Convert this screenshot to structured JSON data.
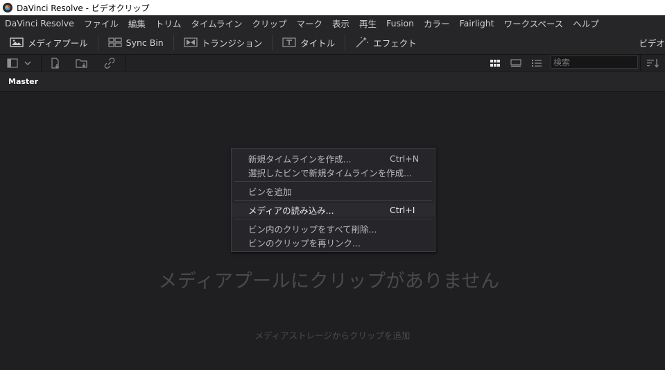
{
  "window": {
    "title": "DaVinci Resolve - ビデオクリップ"
  },
  "menubar": {
    "items": [
      "DaVinci Resolve",
      "ファイル",
      "編集",
      "トリム",
      "タイムライン",
      "クリップ",
      "マーク",
      "表示",
      "再生",
      "Fusion",
      "カラー",
      "Fairlight",
      "ワークスペース",
      "ヘルプ"
    ]
  },
  "toolbar": {
    "media_pool": "メディアプール",
    "sync_bin": "Sync Bin",
    "transitions": "トランジション",
    "titles": "タイトル",
    "effects": "エフェクト",
    "right_label": "ビデオ"
  },
  "search": {
    "placeholder": "検索"
  },
  "bin": {
    "name": "Master"
  },
  "empty": {
    "title": "メディアプールにクリップがありません",
    "hint": "メディアストレージからクリップを追加"
  },
  "context_menu": {
    "new_timeline": "新規タイムラインを作成...",
    "new_timeline_shortcut": "Ctrl+N",
    "new_timeline_selected": "選択したビンで新規タイムラインを作成...",
    "add_bin": "ビンを追加",
    "import_media": "メディアの読み込み...",
    "import_media_shortcut": "Ctrl+I",
    "delete_clips": "ビン内のクリップをすべて削除...",
    "relink_clips": "ビンのクリップを再リンク..."
  },
  "colors": {
    "background": "#1f1f21",
    "panel": "#262628",
    "menu_highlight": "#2b2b2f"
  }
}
